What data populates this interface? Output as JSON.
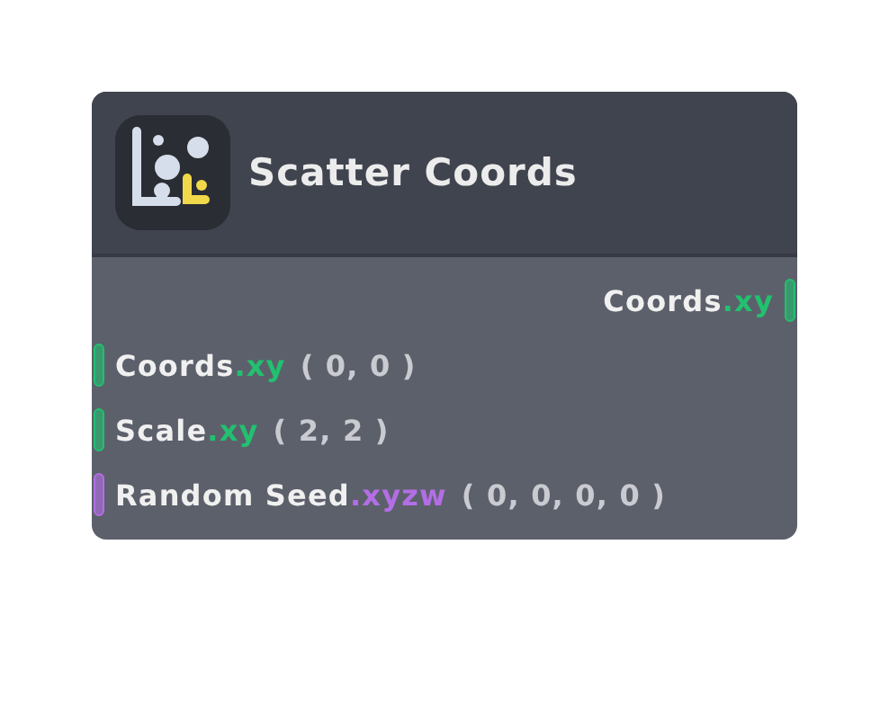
{
  "node": {
    "title": "Scatter Coords",
    "outputs": [
      {
        "name": "Coords",
        "swizzle": ".xy",
        "color": "#22c070"
      }
    ],
    "inputs": [
      {
        "name": "Coords",
        "swizzle": ".xy",
        "value": "( 0, 0 )",
        "color": "#22c070"
      },
      {
        "name": "Scale",
        "swizzle": ".xy",
        "value": "( 2, 2 )",
        "color": "#22c070"
      },
      {
        "name": "Random Seed",
        "swizzle": ".xyzw",
        "value": "( 0, 0, 0, 0 )",
        "color": "#b36ee6"
      }
    ]
  }
}
